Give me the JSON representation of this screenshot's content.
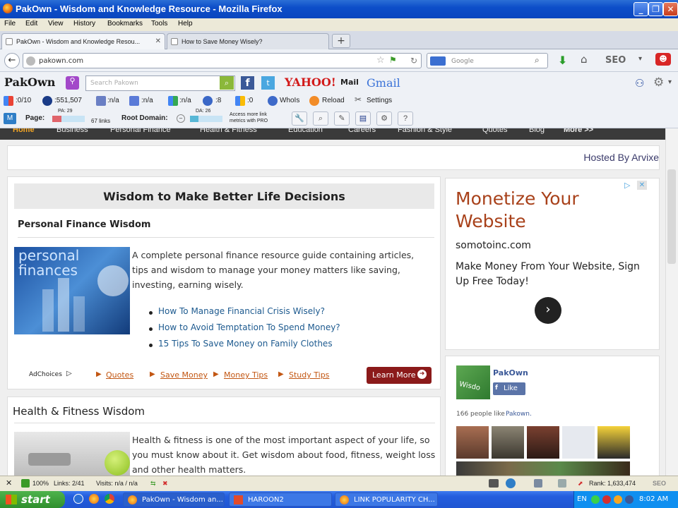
{
  "window": {
    "title": "PakOwn - Wisdom and Knowledge Resource - Mozilla Firefox"
  },
  "menu": [
    "File",
    "Edit",
    "View",
    "History",
    "Bookmarks",
    "Tools",
    "Help"
  ],
  "tabs": [
    {
      "label": "PakOwn - Wisdom and Knowledge Resou..."
    },
    {
      "label": "How to Save Money Wisely?"
    }
  ],
  "nav": {
    "url": "pakown.com",
    "search_placeholder": "Google",
    "seo_label": "SEO"
  },
  "toolbar": {
    "logo": "PakOwn",
    "search_placeholder": "Search Pakown",
    "yahoo": "YAHOO!",
    "mail": "Mail",
    "gmail": "Gmail"
  },
  "seo_bar": {
    "items": [
      ":0/10",
      ":551,507",
      ":n/a",
      ":n/a",
      ":n/a",
      ":8",
      ":0"
    ],
    "whois": "WhoIs",
    "reload": "Reload",
    "settings": "Settings",
    "page_label": "Page:",
    "pa": "PA: 29",
    "links": "67 links",
    "root_label": "Root Domain:",
    "da": "DA: 26",
    "access": "Access more link metrics with PRO",
    "pa_value": 0.29,
    "da_value": 0.26
  },
  "site_nav": [
    "Home",
    "Business",
    "Personal Finance",
    "Health & Fitness",
    "Education",
    "Careers",
    "Fashion & Style",
    "Quotes",
    "Blog",
    "More >>"
  ],
  "hosted": "Hosted By Arvixe",
  "main": {
    "heading": "Wisdom to Make Better Life Decisions",
    "finance": {
      "title": "Personal Finance Wisdom",
      "image_text": "personal finances",
      "description": "A complete personal finance resource guide containing articles, tips and wisdom to manage your money matters like saving, investing, earning wisely.",
      "links": [
        "How To Manage Financial Crisis Wisely?",
        "How to Avoid Temptation To Spend Money?",
        "15 Tips To Save Money on Family Clothes"
      ]
    },
    "adchoices": "AdChoices",
    "adlinks": [
      "Quotes",
      "Save Money",
      "Money Tips",
      "Study Tips"
    ],
    "learn_more": "Learn More",
    "health": {
      "title": "Health & Fitness Wisdom",
      "description": "Health & fitness is one of the most important aspect of your life, so you must know about it. Get wisdom about food, fitness, weight loss and other health matters."
    }
  },
  "ad": {
    "title": "Monetize Your Website",
    "domain": "somotoinc.com",
    "text": "Make Money From Your Website, Sign Up Free Today!"
  },
  "facebook": {
    "page_name": "PakOwn",
    "like": "Like",
    "count_text": "166 people like",
    "count_name": "Pakown."
  },
  "status": {
    "zoom": "100%",
    "links": "Links: 2/41",
    "visits": "Visits: n/a / n/a",
    "rank": "Rank: 1,633,474"
  },
  "taskbar": {
    "start": "start",
    "tasks": [
      "PakOwn - Wisdom an...",
      "HAROON2",
      "LINK POPULARITY CH..."
    ],
    "lang": "EN",
    "time": "8:02 AM"
  }
}
